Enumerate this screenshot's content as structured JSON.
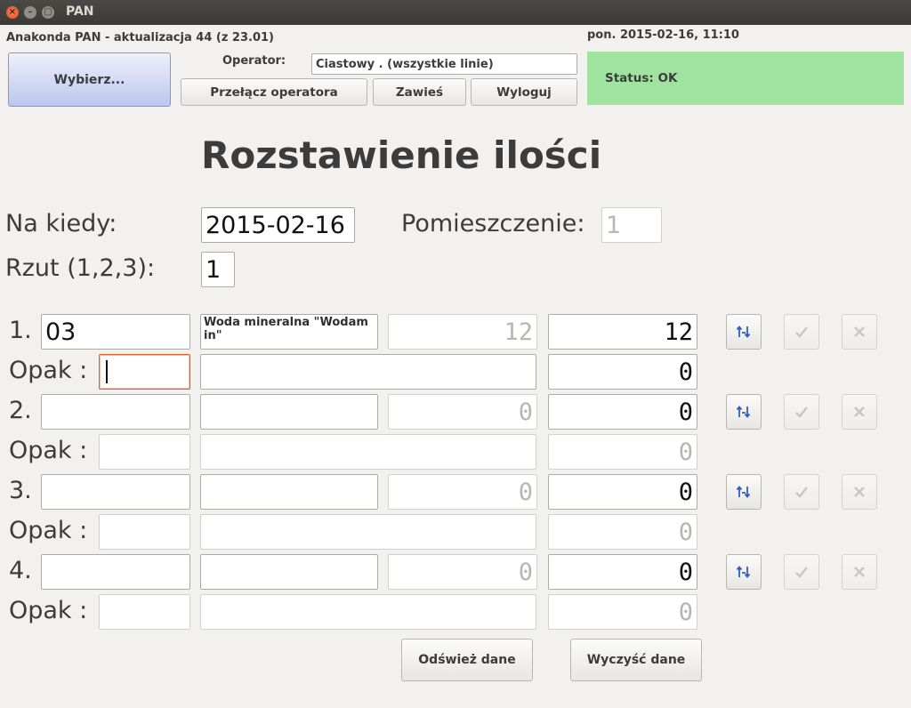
{
  "window": {
    "title": "PAN"
  },
  "header": {
    "app_version": "Anakonda PAN - aktualizacja 44 (z 23.01)",
    "datetime": "pon. 2015-02-16, 11:10",
    "choose_label": "Wybierz...",
    "operator_label": "Operator:",
    "operator_value": "Ciastowy . (wszystkie linie)",
    "switch_operator_label": "Przełącz operatora",
    "suspend_label": "Zawieś",
    "logout_label": "Wyloguj",
    "status_text": "Status: OK",
    "status_color": "#a0e3a0"
  },
  "form": {
    "title": "Rozstawienie ilości",
    "when_label": "Na kiedy:",
    "when_value": "2015-02-16",
    "room_label": "Pomieszczenie:",
    "room_value": "1",
    "projection_label": "Rzut (1,2,3):",
    "projection_value": "1"
  },
  "rows": [
    {
      "number": "1.",
      "code": "03",
      "product": "Woda mineralna \"Wodam in\"",
      "planned": "12",
      "quantity": "12",
      "pack_label": "Opak :",
      "pack_code": "",
      "pack_name": "",
      "pack_quantity": "0"
    },
    {
      "number": "2.",
      "code": "",
      "product": "",
      "planned": "0",
      "quantity": "0",
      "pack_label": "Opak :",
      "pack_code": "",
      "pack_name": "",
      "pack_quantity": "0"
    },
    {
      "number": "3.",
      "code": "",
      "product": "",
      "planned": "0",
      "quantity": "0",
      "pack_label": "Opak :",
      "pack_code": "",
      "pack_name": "",
      "pack_quantity": "0"
    },
    {
      "number": "4.",
      "code": "",
      "product": "",
      "planned": "0",
      "quantity": "0",
      "pack_label": "Opak :",
      "pack_code": "",
      "pack_name": "",
      "pack_quantity": "0"
    }
  ],
  "actions": {
    "refresh_label": "Odśwież dane",
    "clear_label": "Wyczyść dane"
  },
  "icons": {
    "row_select": "swap-arrows-icon",
    "row_confirm": "checkmark-icon",
    "row_delete": "x-icon"
  }
}
